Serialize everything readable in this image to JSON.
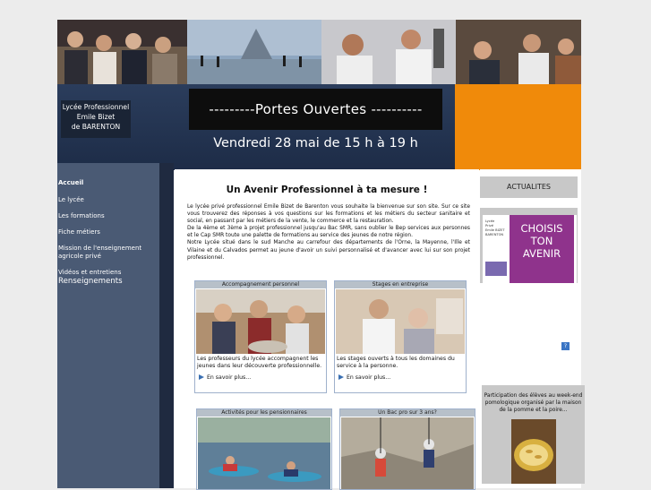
{
  "header": {
    "school_line1": "Lycée Professionnel",
    "school_line2": "Emile Bizet",
    "school_line3": "de BARENTON",
    "banner_title": "---------Portes Ouvertes ----------",
    "banner_date": "Vendredi 28 mai de 15 h à 19 h"
  },
  "nav": {
    "items": [
      {
        "label": "Accueil"
      },
      {
        "label": "Le lycée"
      },
      {
        "label": "Les formations"
      },
      {
        "label": "Fiche métiers"
      },
      {
        "label": "Mission de l'enseignement agricole privé"
      },
      {
        "label": "Vidéos et entretiens"
      },
      {
        "label": "Renseignements"
      }
    ]
  },
  "main": {
    "title": "Un Avenir Professionnel à ta mesure !",
    "paragraph1": "Le lycée privé professionnel Emile Bizet de Barenton vous souhaite la bienvenue sur son site. Sur ce site vous trouverez des réponses à vos questions sur les formations et les métiers du secteur sanitaire et social, en passant par les métiers de la vente, le commerce et la restauration.",
    "paragraph2": "De la 4ème et 3ème à projet professionnel jusqu'au Bac SMR, sans oublier le Bep services aux personnes et le Cap SMR toute une palette de formations au service des jeunes de notre région.",
    "paragraph3": "Notre Lycée situé dans le sud Manche au carrefour des départements de l'Orne, la Mayenne, l'Ille et Vilaine et du Calvados permet au jeune d'avoir un suivi personnalisé et d'avancer avec lui sur son projet professionnel."
  },
  "boxes": [
    {
      "title": "Accompagnement personnel",
      "caption": "Les professeurs du lycée accompagnent les jeunes dans leur découverte professionnelle.",
      "more": "En savoir plus..."
    },
    {
      "title": "Stages en entreprise",
      "caption": "Les stages ouverts à tous les domaines du service à la personne.",
      "more": "En savoir plus..."
    },
    {
      "title": "Activités pour les pensionnaires"
    },
    {
      "title": "Un Bac pro sur 3 ans?"
    }
  ],
  "right": {
    "actualites": "ACTUALITES",
    "poster_small_line1": "Lycée",
    "poster_small_line2": "Privé",
    "poster_small_line3": "Emile BIZET",
    "poster_small_line4": "BARENTON",
    "poster_line1": "CHOISIS",
    "poster_line2": "TON",
    "poster_line3": "AVENIR",
    "participation": "Participation des élèves au week-end pomologique organisé par la maison de la pomme et la poire..."
  },
  "colors": {
    "nav_bg": "#4a5a74",
    "banner_orange": "#f08a0a",
    "box_border": "#9fb1cc",
    "arrow_blue": "#3a6fb2"
  }
}
